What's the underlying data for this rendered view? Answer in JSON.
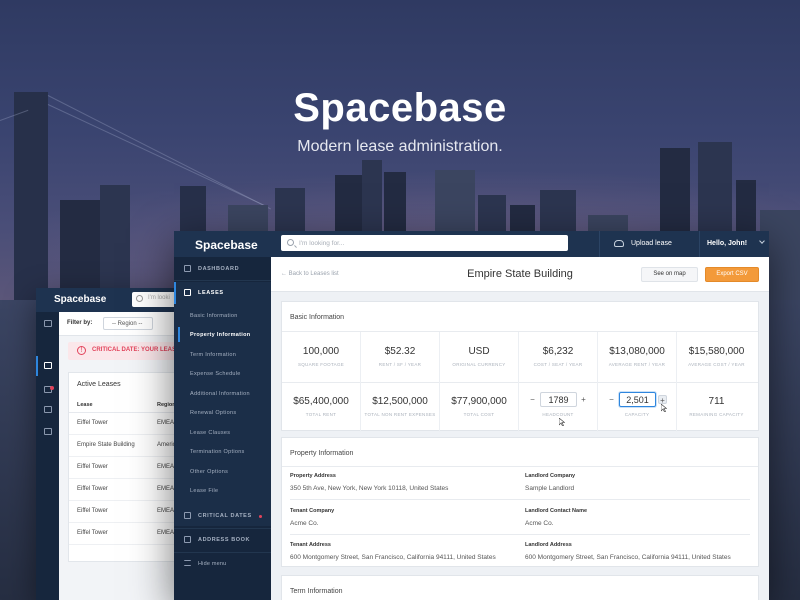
{
  "hero": {
    "title": "Spacebase",
    "subtitle": "Modern lease administration."
  },
  "colors": {
    "navy_topbar": "#1e3350",
    "sidebar": "#16263d",
    "accent_blue": "#2e86de",
    "export_orange": "#f39a3a",
    "alert_red": "#e2435b"
  },
  "back_window": {
    "logo": "Spacebase",
    "search_placeholder": "I'm looki",
    "filter_label": "Filter by:",
    "filter_value": "-- Region --",
    "alert": "CRITICAL DATE:  YOUR LEASE A",
    "table_title": "Active Leases",
    "columns": [
      "Lease",
      "Region"
    ],
    "rows": [
      [
        "Eiffel Tower",
        "EMEA"
      ],
      [
        "Empire State Building",
        "Americ"
      ],
      [
        "Eiffel Tower",
        "EMEA"
      ],
      [
        "Eiffel Tower",
        "EMEA"
      ],
      [
        "Eiffel Tower",
        "EMEA"
      ],
      [
        "Eiffel Tower",
        "EMEA"
      ]
    ],
    "icons": [
      "home-icon",
      "briefcase-icon",
      "calendar-icon",
      "address-book-icon",
      "menu-icon"
    ]
  },
  "app": {
    "logo": "Spacebase",
    "search_placeholder": "I'm looking for...",
    "upload_label": "Upload lease",
    "user_greeting": "Hello, John!",
    "nav": {
      "dashboard": "DASHBOARD",
      "leases": "LEASES",
      "critical_dates": "CRITICAL DATES",
      "address_book": "ADDRESS BOOK",
      "hide_menu": "Hide menu"
    },
    "subnav": [
      "Basic Information",
      "Property Information",
      "Term Information",
      "Expense Schedule",
      "Additional Information",
      "Renewal Options",
      "Lease Clauses",
      "Termination Options",
      "Other Options",
      "Lease File"
    ],
    "back_link": "Back to Leases list",
    "page_title": "Empire State Building",
    "see_on_map": "See on map",
    "export_csv": "Export CSV",
    "basic_info": {
      "title": "Basic Information",
      "row1": [
        {
          "value": "100,000",
          "label": "SQUARE FOOTAGE"
        },
        {
          "value": "$52.32",
          "label": "RENT / SF / YEAR"
        },
        {
          "value": "USD",
          "label": "ORIGINAL CURRENCY"
        },
        {
          "value": "$6,232",
          "label": "COST / SEAT / YEAR"
        },
        {
          "value": "$13,080,000",
          "label": "AVERAGE RENT / YEAR"
        },
        {
          "value": "$15,580,000",
          "label": "AVERAGE COST / YEAR"
        }
      ],
      "row2": [
        {
          "value": "$65,400,000",
          "label": "TOTAL RENT"
        },
        {
          "value": "$12,500,000",
          "label": "TOTAL NON RENT EXPENSES"
        },
        {
          "value": "$77,900,000",
          "label": "TOTAL COST"
        }
      ],
      "headcount": {
        "value": "1789",
        "label": "HEADCOUNT"
      },
      "capacity": {
        "value": "2,501",
        "label": "CAPACITY"
      },
      "remaining": {
        "value": "711",
        "label": "REMAINING CAPACITY"
      },
      "minus": "−",
      "plus": "+"
    },
    "property_info": {
      "title": "Property Information",
      "property_address_label": "Property Address",
      "property_address": "350 5th Ave, New York, New York 10118, United States",
      "landlord_company_label": "Landlord Company",
      "landlord_company": "Sample Landlord",
      "tenant_company_label": "Tenant Company",
      "tenant_company": "Acme Co.",
      "landlord_contact_label": "Landlord Contact Name",
      "landlord_contact": "Acme Co.",
      "tenant_address_label": "Tenant Address",
      "tenant_address": "600 Montgomery Street, San Francisco, California 94111, United States",
      "landlord_address_label": "Landlord Address",
      "landlord_address": "600 Montgomery Street, San Francisco, California 94111, United States"
    },
    "term_info": {
      "title": "Term Information"
    }
  }
}
